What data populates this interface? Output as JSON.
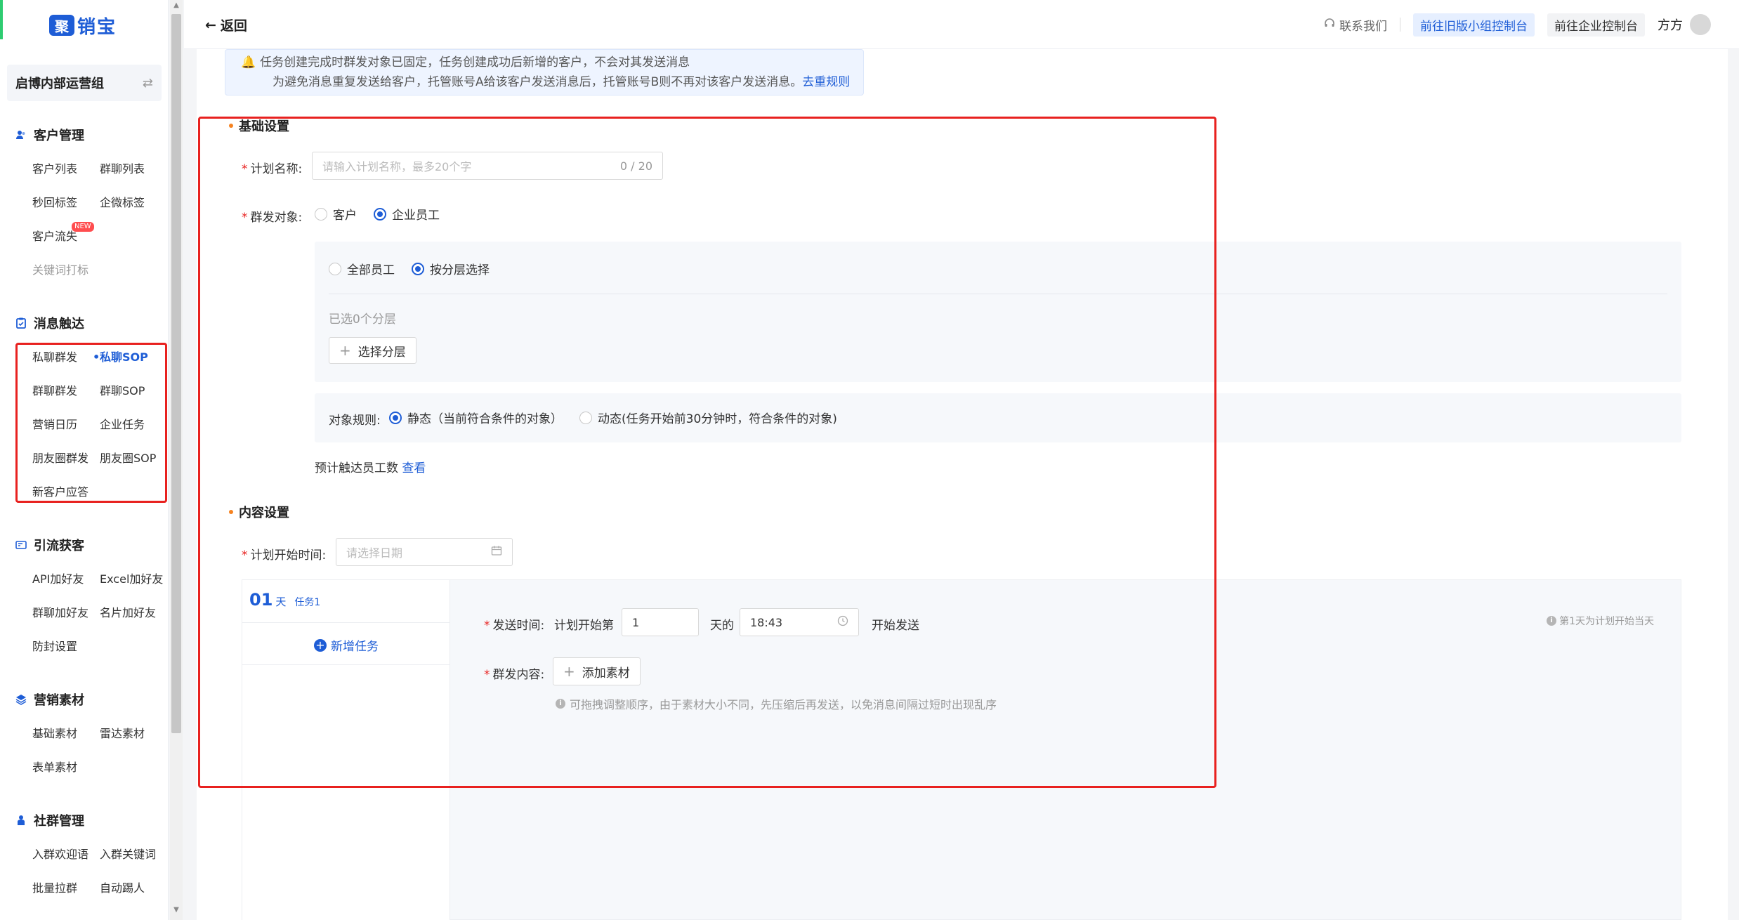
{
  "colors": {
    "brand": "#1e5dd6",
    "highlight": "#e8211f",
    "required": "#e8211f",
    "new_badge": "#ff4d4f"
  },
  "sidebar": {
    "logo_mark": "聚",
    "logo_text": "销宝",
    "org": "启博内部运营组",
    "sections": [
      {
        "title": "客户管理",
        "icon": "user-group-icon",
        "items": [
          {
            "label": "客户列表"
          },
          {
            "label": "群聊列表"
          },
          {
            "label": "秒回标签"
          },
          {
            "label": "企微标签"
          },
          {
            "label": "客户流失",
            "badge": "NEW"
          },
          {
            "label": "关键词打标"
          }
        ]
      },
      {
        "title": "消息触达",
        "icon": "clipboard-icon",
        "items": [
          {
            "label": "私聊群发"
          },
          {
            "label": "私聊SOP"
          },
          {
            "label": "群聊群发"
          },
          {
            "label": "群聊SOP"
          },
          {
            "label": "营销日历"
          },
          {
            "label": "企业任务"
          },
          {
            "label": "朋友圈群发"
          },
          {
            "label": "朋友圈SOP"
          },
          {
            "label": "新客户应答"
          }
        ]
      },
      {
        "title": "引流获客",
        "icon": "mail-icon",
        "items": [
          {
            "label": "API加好友"
          },
          {
            "label": "Excel加好友"
          },
          {
            "label": "群聊加好友"
          },
          {
            "label": "名片加好友"
          },
          {
            "label": "防封设置"
          }
        ]
      },
      {
        "title": "营销素材",
        "icon": "layers-icon",
        "items": [
          {
            "label": "基础素材"
          },
          {
            "label": "雷达素材"
          },
          {
            "label": "表单素材"
          }
        ]
      },
      {
        "title": "社群管理",
        "icon": "people-icon",
        "items": [
          {
            "label": "入群欢迎语"
          },
          {
            "label": "入群关键词"
          },
          {
            "label": "批量拉群"
          },
          {
            "label": "自动踢人"
          }
        ]
      }
    ]
  },
  "topbar": {
    "back": "返回",
    "contact": "联系我们",
    "old_console": "前往旧版小组控制台",
    "enterprise_console": "前往企业控制台",
    "user": "方方"
  },
  "notice": {
    "line1": "任务创建完成时群发对象已固定，任务创建成功后新增的客户，不会对其发送消息",
    "line2": "为避免消息重复发送给客户，托管账号A给该客户发送消息后，托管账号B则不再对该客户发送消息。",
    "link": "去重规则"
  },
  "basic": {
    "title": "基础设置",
    "plan_name_label": "计划名称:",
    "plan_name_placeholder": "请输入计划名称，最多20个字",
    "plan_name_counter": "0 / 20",
    "target_label": "群发对象:",
    "target_opt1": "客户",
    "target_opt2": "企业员工",
    "scope_opt1": "全部员工",
    "scope_opt2": "按分层选择",
    "selected_layers": "已选0个分层",
    "select_layer_btn": "选择分层",
    "rule_label": "对象规则:",
    "rule_opt1": "静态（当前符合条件的对象）",
    "rule_opt2": "动态(任务开始前30分钟时，符合条件的对象)",
    "estimate_label": "预计触达员工数",
    "estimate_link": "查看"
  },
  "content_settings": {
    "title": "内容设置",
    "start_label": "计划开始时间:",
    "start_placeholder": "请选择日期",
    "day_num": "01",
    "day_unit": "天",
    "task_tag": "任务1",
    "add_task": "新增任务",
    "send_label": "发送时间:",
    "send_prefix": "计划开始第",
    "send_day_value": "1",
    "send_day_suffix": "天的",
    "send_time_value": "18:43",
    "send_suffix": "开始发送",
    "send_tip": "第1天为计划开始当天",
    "material_label": "群发内容:",
    "add_material": "添加素材",
    "material_hint": "可拖拽调整顺序，由于素材大小不同，先压缩后再发送，以免消息间隔过短时出现乱序"
  }
}
